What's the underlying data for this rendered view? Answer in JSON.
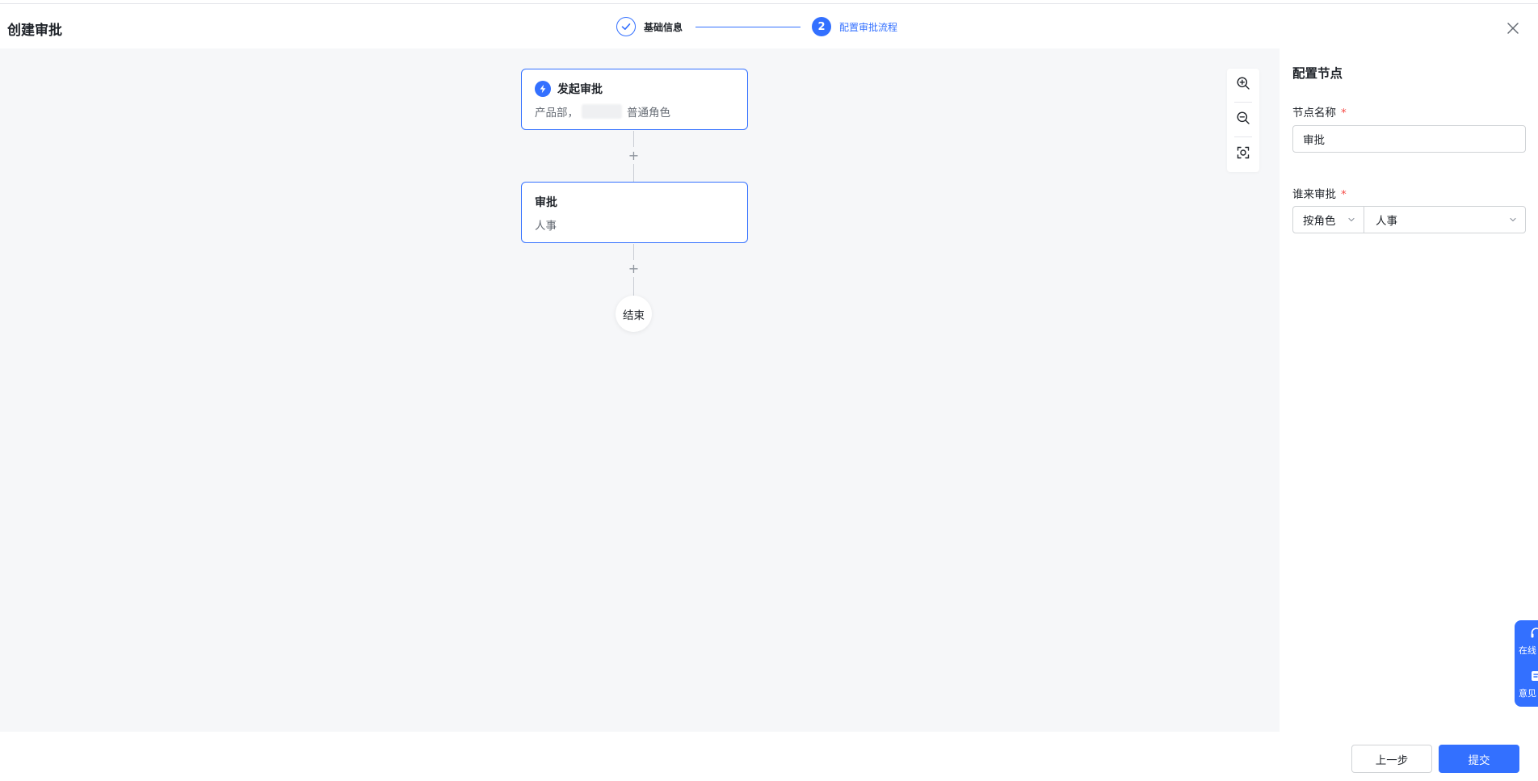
{
  "header": {
    "title": "创建审批",
    "steps": [
      {
        "index": "1",
        "label": "基础信息",
        "state": "done"
      },
      {
        "index": "2",
        "label": "配置审批流程",
        "state": "active"
      }
    ]
  },
  "flow": {
    "start_node": {
      "title": "发起审批",
      "sub_prefix": "产品部，",
      "sub_suffix": "普通角色"
    },
    "approve_node": {
      "title": "审批",
      "sub": "人事"
    },
    "add_symbol": "+",
    "end_label": "结束"
  },
  "panel": {
    "title": "配置节点",
    "node_name_label": "节点名称",
    "node_name_value": "审批",
    "approver_label": "谁来审批",
    "approver_type": "按角色",
    "approver_value": "人事",
    "required_mark": "*"
  },
  "floating": {
    "item1": "在线",
    "item2": "意见"
  },
  "footer": {
    "prev_label": "上一步",
    "submit_label": "提交"
  },
  "colors": {
    "primary": "#3370ff",
    "canvas_bg": "#f6f7f9",
    "required": "#f54a45"
  }
}
